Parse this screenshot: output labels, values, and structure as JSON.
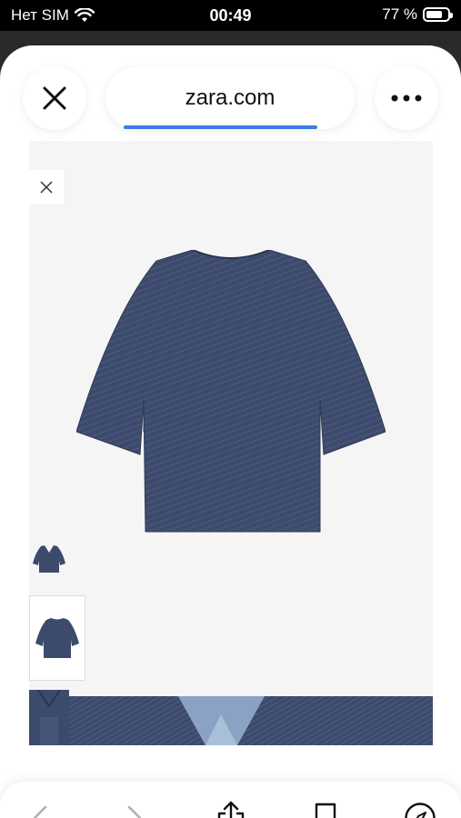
{
  "status_bar": {
    "carrier": "Нет SIM",
    "time": "00:49",
    "battery_percent": "77 %",
    "battery_level": 0.77
  },
  "browser": {
    "url": "zara.com",
    "close_icon": "close-icon",
    "more_icon": "more-icon",
    "load_progress": 0.8,
    "accent_color": "#3b7ce6"
  },
  "product_viewer": {
    "product_color": "#3c4a6b",
    "background_color": "#f5f5f5",
    "thumbnails": [
      "front",
      "back",
      "detail"
    ]
  },
  "toolbar": {
    "icons": [
      "back-arrow-icon",
      "forward-arrow-icon",
      "share-icon",
      "bookmark-icon",
      "compass-icon"
    ]
  }
}
